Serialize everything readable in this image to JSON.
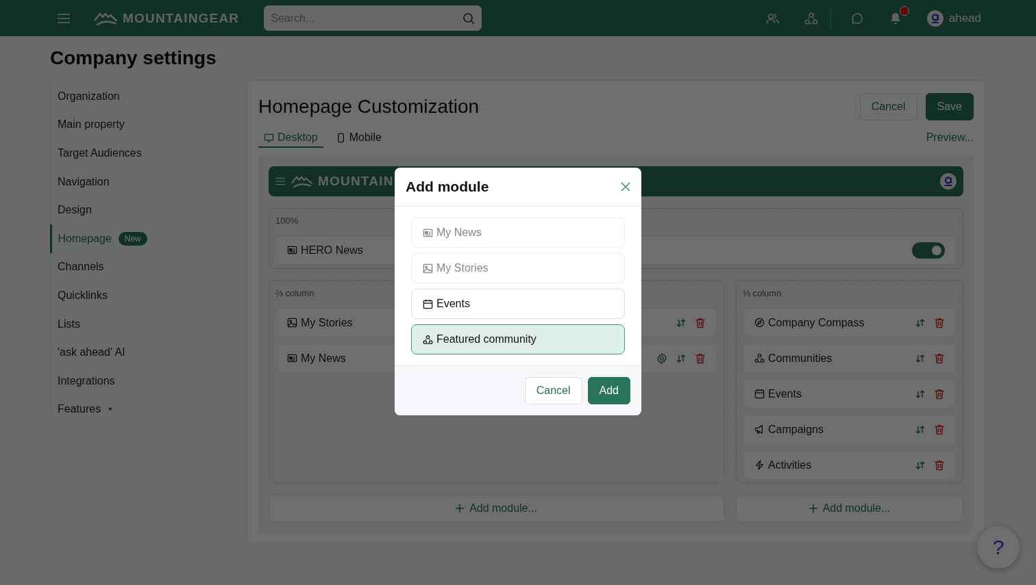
{
  "header": {
    "brand": "MOUNTAINGEAR",
    "search": {
      "placeholder": "Search..."
    },
    "notification_badge": true,
    "user": "ahead"
  },
  "page_title": "Company settings",
  "sidebar": {
    "items": [
      {
        "label": "Organization",
        "selected": false
      },
      {
        "label": "Main property",
        "selected": false
      },
      {
        "label": "Target Audiences",
        "selected": false
      },
      {
        "label": "Navigation",
        "selected": false
      },
      {
        "label": "Design",
        "selected": false
      },
      {
        "label": "Homepage",
        "selected": true,
        "badge": "New"
      },
      {
        "label": "Channels",
        "selected": false
      },
      {
        "label": "Quicklinks",
        "selected": false
      },
      {
        "label": "Lists",
        "selected": false
      },
      {
        "label": "'ask ahead' AI",
        "selected": false
      },
      {
        "label": "Integrations",
        "selected": false
      },
      {
        "label": "Features",
        "selected": false,
        "has_menu": true
      }
    ]
  },
  "editor": {
    "title": "Homepage Customization",
    "buttons": [
      {
        "label": "Cancel",
        "kind": "secondary"
      },
      {
        "label": "Save",
        "kind": "primary"
      }
    ],
    "tabs": [
      {
        "label": "Desktop",
        "kind": "desktop",
        "selected": true
      },
      {
        "label": "Mobile",
        "kind": "mobile",
        "selected": false
      }
    ],
    "preview_link": "Preview...",
    "preview": {
      "brand": "MOUNTAIN",
      "full_width": {
        "label": "100%",
        "modules": [
          {
            "label": "HERO News",
            "kind": "news",
            "on": true
          }
        ]
      },
      "columns": [
        {
          "label": "⅔ column",
          "add_label": "Add module...",
          "modules": [
            {
              "label": "My Stories",
              "kind": "stories",
              "configurable": false
            },
            {
              "label": "My News",
              "kind": "news",
              "configurable": true
            }
          ]
        },
        {
          "label": "⅓ column",
          "add_label": "Add module...",
          "modules": [
            {
              "label": "Company Compass",
              "kind": "compass",
              "configurable": false
            },
            {
              "label": "Communities",
              "kind": "community",
              "configurable": false
            },
            {
              "label": "Events",
              "kind": "events",
              "configurable": false
            },
            {
              "label": "Campaigns",
              "kind": "campaigns",
              "configurable": false
            },
            {
              "label": "Activities",
              "kind": "activities",
              "configurable": false
            }
          ]
        }
      ]
    }
  },
  "dialog": {
    "title": "Add module",
    "options": [
      {
        "label": "My News",
        "kind": "news",
        "disabled": true,
        "selected": false
      },
      {
        "label": "My Stories",
        "kind": "stories",
        "disabled": true,
        "selected": false
      },
      {
        "label": "Events",
        "kind": "events",
        "disabled": false,
        "selected": false
      },
      {
        "label": "Featured community",
        "kind": "community",
        "disabled": false,
        "selected": true
      }
    ],
    "buttons": [
      {
        "label": "Cancel",
        "kind": "secondary"
      },
      {
        "label": "Add",
        "kind": "primary"
      }
    ]
  },
  "help": "?"
}
